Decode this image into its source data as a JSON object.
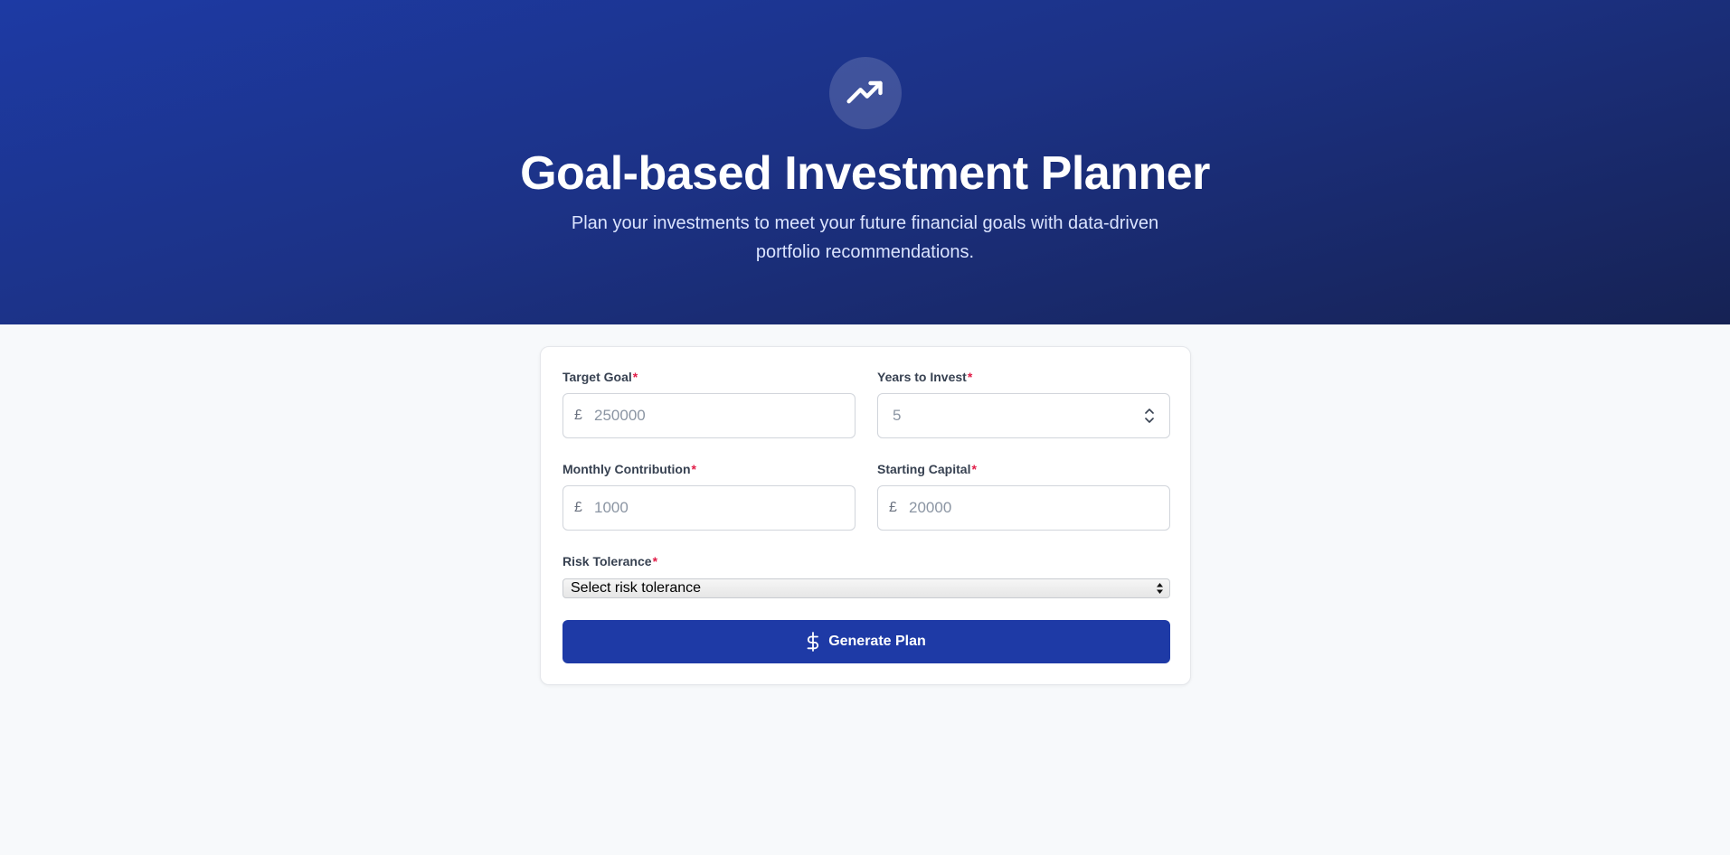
{
  "header": {
    "icon": "trending-up-icon",
    "title": "Goal-based Investment Planner",
    "subtitle": "Plan your investments to meet your future financial goals with data-driven portfolio recommendations."
  },
  "form": {
    "required_marker": "*",
    "currency_symbol": "£",
    "target_goal": {
      "label": "Target Goal",
      "placeholder": "250000"
    },
    "years_to_invest": {
      "label": "Years to Invest",
      "placeholder": "5"
    },
    "monthly_contribution": {
      "label": "Monthly Contribution",
      "placeholder": "1000"
    },
    "starting_capital": {
      "label": "Starting Capital",
      "placeholder": "20000"
    },
    "risk_tolerance": {
      "label": "Risk Tolerance",
      "selected": "Select risk tolerance"
    },
    "submit": {
      "label": "Generate Plan",
      "icon": "dollar-icon"
    }
  },
  "colors": {
    "accent": "#1e3aa6",
    "required": "#e11d48",
    "hero_start": "#1d3aa4",
    "hero_end": "#162254"
  }
}
